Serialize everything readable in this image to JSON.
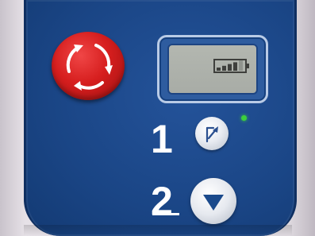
{
  "labels": {
    "step1": "1",
    "step2": "2"
  },
  "indicators": {
    "status_led": {
      "state": "on",
      "color": "#3ccf3c"
    },
    "battery": {
      "total_bars": 5,
      "filled_bars": 4
    }
  },
  "icons": {
    "emergency_stop": "rotate-arrows-icon",
    "function_button": "signal-arrow-icon",
    "down_button": "triangle-down-icon"
  },
  "colors": {
    "panel": "#1a4585",
    "emergency_stop": "#d61e1e",
    "lcd": "#abafa9"
  }
}
